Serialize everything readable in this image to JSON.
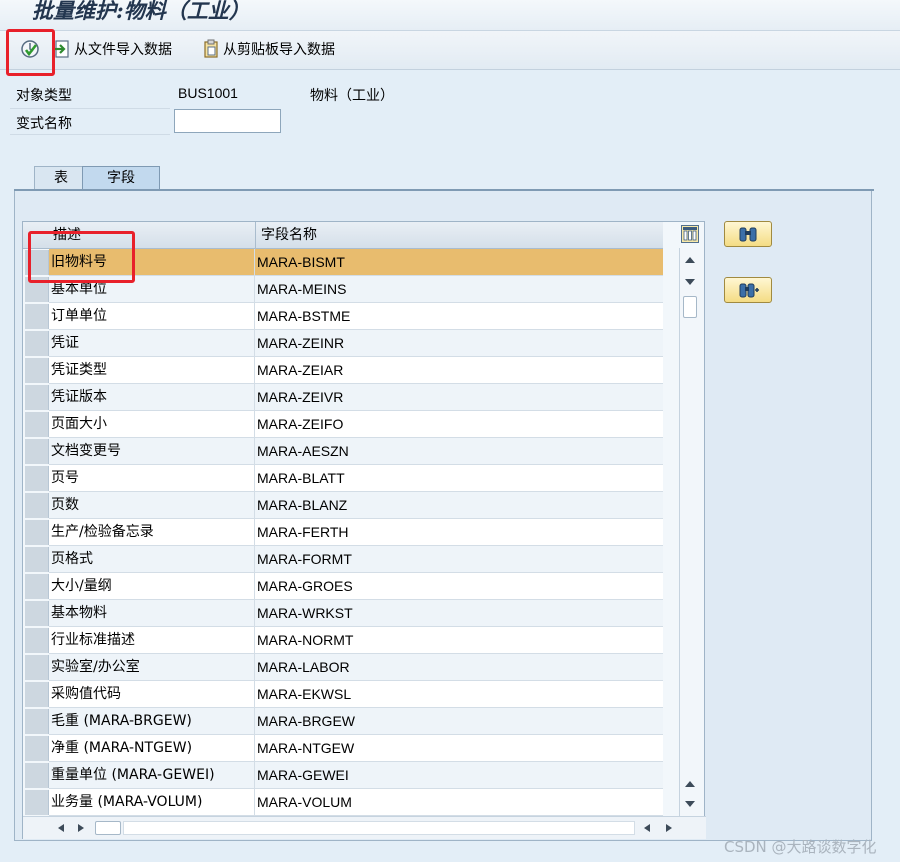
{
  "window": {
    "title": "批量维护:物料（工业）"
  },
  "toolbar": {
    "import_file_label": "从文件导入数据",
    "import_clipboard_label": "从剪贴板导入数据"
  },
  "header": {
    "object_type_label": "对象类型",
    "object_type_value": "BUS1001",
    "object_type_desc": "物料（工业）",
    "variant_label": "变式名称",
    "variant_value": ""
  },
  "tabs": [
    {
      "label": "表"
    },
    {
      "label": "字段"
    }
  ],
  "grid": {
    "columns": [
      "描述",
      "字段名称"
    ],
    "rows": [
      {
        "desc": "旧物料号",
        "field": "MARA-BISMT"
      },
      {
        "desc": "基本单位",
        "field": "MARA-MEINS"
      },
      {
        "desc": "订单单位",
        "field": "MARA-BSTME"
      },
      {
        "desc": "凭证",
        "field": "MARA-ZEINR"
      },
      {
        "desc": "凭证类型",
        "field": "MARA-ZEIAR"
      },
      {
        "desc": "凭证版本",
        "field": "MARA-ZEIVR"
      },
      {
        "desc": "页面大小",
        "field": "MARA-ZEIFO"
      },
      {
        "desc": "文档变更号",
        "field": "MARA-AESZN"
      },
      {
        "desc": "页号",
        "field": "MARA-BLATT"
      },
      {
        "desc": "页数",
        "field": "MARA-BLANZ"
      },
      {
        "desc": "生产/检验备忘录",
        "field": "MARA-FERTH"
      },
      {
        "desc": "页格式",
        "field": "MARA-FORMT"
      },
      {
        "desc": "大小/量纲",
        "field": "MARA-GROES"
      },
      {
        "desc": "基本物料",
        "field": "MARA-WRKST"
      },
      {
        "desc": "行业标准描述",
        "field": "MARA-NORMT"
      },
      {
        "desc": "实验室/办公室",
        "field": "MARA-LABOR"
      },
      {
        "desc": "采购值代码",
        "field": "MARA-EKWSL"
      },
      {
        "desc": "毛重 (MARA-BRGEW)",
        "field": "MARA-BRGEW"
      },
      {
        "desc": "净重 (MARA-NTGEW)",
        "field": "MARA-NTGEW"
      },
      {
        "desc": "重量单位 (MARA-GEWEI)",
        "field": "MARA-GEWEI"
      },
      {
        "desc": "业务量 (MARA-VOLUM)",
        "field": "MARA-VOLUM"
      }
    ]
  },
  "watermark": "CSDN @大路谈数字化",
  "colors": {
    "selected_row": "#e8bc6e",
    "highlight_box": "#e8202a",
    "background": "#e3eef7"
  }
}
